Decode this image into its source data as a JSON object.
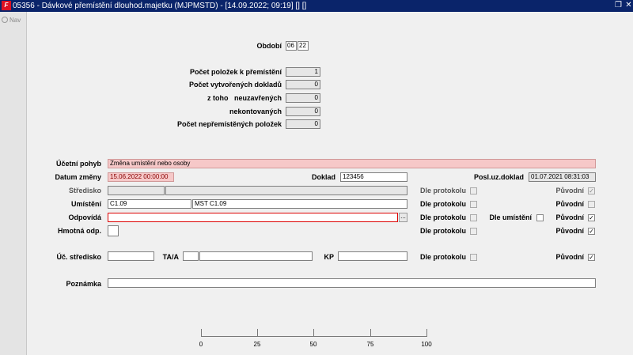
{
  "window": {
    "title": "05356 - Dávkové přemístění dlouhod.majetku (MJPMSTD) - [14.09.2022; 09:19] [] []",
    "restore_icon": "restore-icon",
    "close_icon": "close-icon"
  },
  "sidebar": {
    "nav_label": "Nav"
  },
  "obdobi": {
    "label": "Období",
    "month": "06",
    "year": "22"
  },
  "counts": {
    "pocet_polozek": {
      "label": "Počet položek k přemístění",
      "value": "1"
    },
    "pocet_dokladu": {
      "label": "Počet vytvořených dokladů",
      "value": "0"
    },
    "z_toho": {
      "label": "z toho   neuzavřených",
      "value": "0"
    },
    "nekontovanych": {
      "label": "nekontovaných",
      "value": "0"
    },
    "nepremistenych": {
      "label": "Počet nepřemístěných položek",
      "value": "0"
    }
  },
  "form": {
    "ucetni_pohyb": {
      "label": "Účetní pohyb",
      "value": "Změna umístění nebo osoby"
    },
    "datum_zmeny": {
      "label": "Datum změny",
      "value": "15.06.2022 00:00:00"
    },
    "doklad": {
      "label": "Doklad",
      "value": "123456"
    },
    "posl_uz_doklad": {
      "label": "Posl.uz.doklad",
      "value": "01.07.2021 08:31:03"
    },
    "stredisko": {
      "label": "Středisko",
      "code": "",
      "name": ""
    },
    "umisteni": {
      "label": "Umístění",
      "code": "C1.09",
      "name": "MST C1.09"
    },
    "odpovida": {
      "label": "Odpovídá",
      "value": "",
      "lookup": "..."
    },
    "hmotna_odp": {
      "label": "Hmotná odp."
    },
    "uct_stredisko": {
      "label": "Úč. středisko",
      "value": ""
    },
    "taa": {
      "label": "TA/A",
      "a": "",
      "b": ""
    },
    "kp": {
      "label": "KP",
      "value": ""
    },
    "poznamka": {
      "label": "Poznámka",
      "value": ""
    },
    "dle_protokolu": "Dle protokolu",
    "dle_umisteni": "Dle umístění",
    "puvodni": "Původní",
    "check_mark": "✓"
  },
  "progress": {
    "ticks": [
      "0",
      "25",
      "50",
      "75",
      "100"
    ],
    "value": 0
  }
}
